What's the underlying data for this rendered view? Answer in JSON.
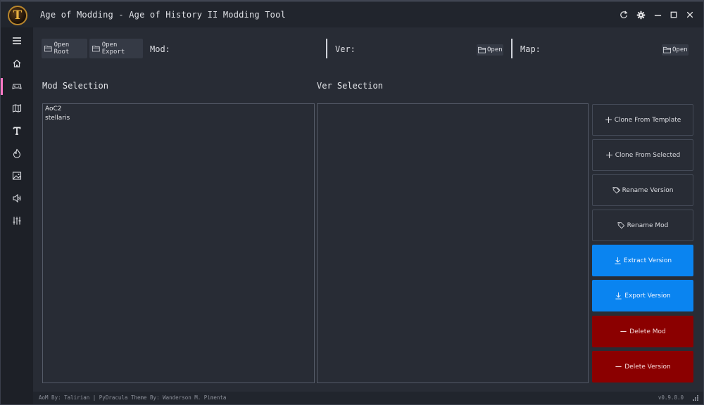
{
  "window": {
    "logo_letter": "T",
    "title": "Age of Modding - Age of History II Modding Tool"
  },
  "titlebar_controls": [
    "refresh-icon",
    "gear-icon",
    "minimize-icon",
    "maximize-icon",
    "close-icon"
  ],
  "nav": {
    "items": [
      "menu-icon",
      "home-icon",
      "gamepad-icon",
      "map-icon",
      "text-icon",
      "fire-icon",
      "image-icon",
      "sound-icon",
      "sliders-icon"
    ],
    "active_index": 2,
    "active_color": "#ff79c6"
  },
  "toolbar": {
    "open_root": "Open Root",
    "open_export": "Open Export",
    "mod_label": "Mod:",
    "ver_label": "Ver:",
    "ver_open": "Open",
    "map_label": "Map:",
    "map_open": "Open"
  },
  "mod_selection": {
    "title": "Mod Selection",
    "items": [
      "AoC2",
      "stellaris"
    ]
  },
  "ver_selection": {
    "title": "Ver Selection",
    "items": []
  },
  "actions": {
    "clone_template": "Clone From Template",
    "clone_selected": "Clone From Selected",
    "rename_version": "Rename Version",
    "rename_mod": "Rename Mod",
    "extract_version": "Extract Version",
    "export_version": "Export Version",
    "delete_mod": "Delete Mod",
    "delete_version": "Delete Version"
  },
  "colors": {
    "accent_blue": "#0a84f0",
    "danger_red": "#8b0000",
    "background": "#282c35"
  },
  "footer": {
    "credits": "AoM By: Talirian | PyDracula Theme By: Wanderson M. Pimenta",
    "version": "v0.9.8.0"
  }
}
